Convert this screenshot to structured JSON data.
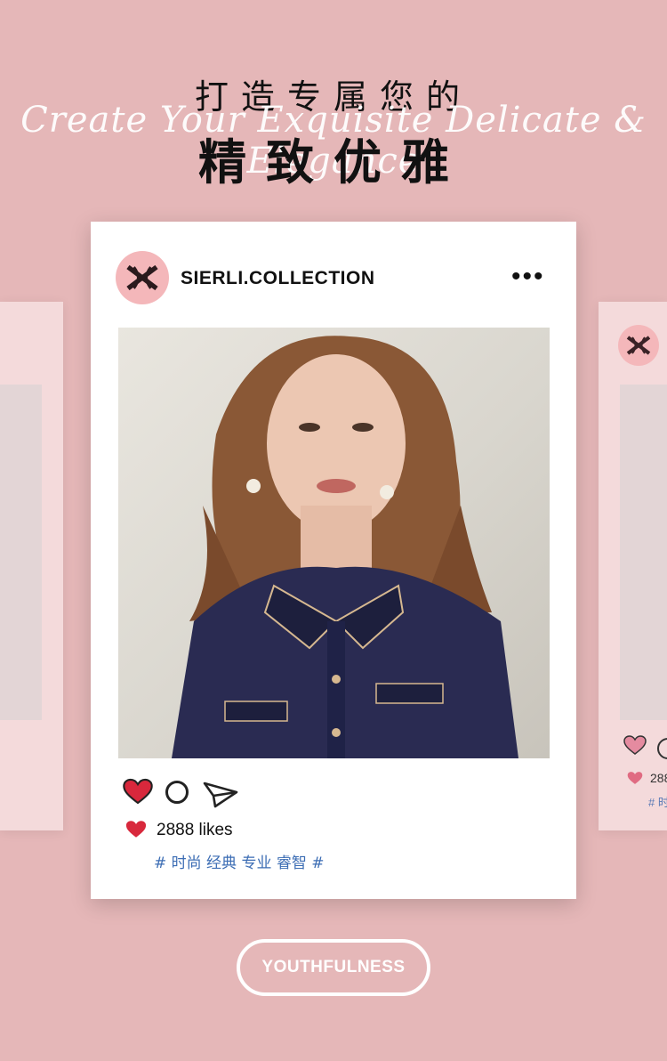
{
  "headline": {
    "top_line": "打造专属您的",
    "script_line": "Create Your Exquisite Delicate & Elegance",
    "main_line": "精致优雅"
  },
  "post": {
    "username": "SIERLI.COLLECTION",
    "more_glyph": "•••",
    "likes_text": "2888 likes",
    "tags_text": "# 时尚 经典 专业 睿智 #"
  },
  "ghost_right": {
    "likes_text": "288",
    "tags_text": "# 时"
  },
  "badge": {
    "label": "YOUTHFULNESS"
  },
  "colors": {
    "background": "#e5b7b8",
    "card": "#ffffff",
    "avatar_pink": "#f4b7ba",
    "heart_red": "#d8283c",
    "tag_blue": "#3c6db4"
  },
  "icons": [
    "logo-icon",
    "more-icon",
    "heart-icon",
    "comment-icon",
    "share-icon"
  ]
}
